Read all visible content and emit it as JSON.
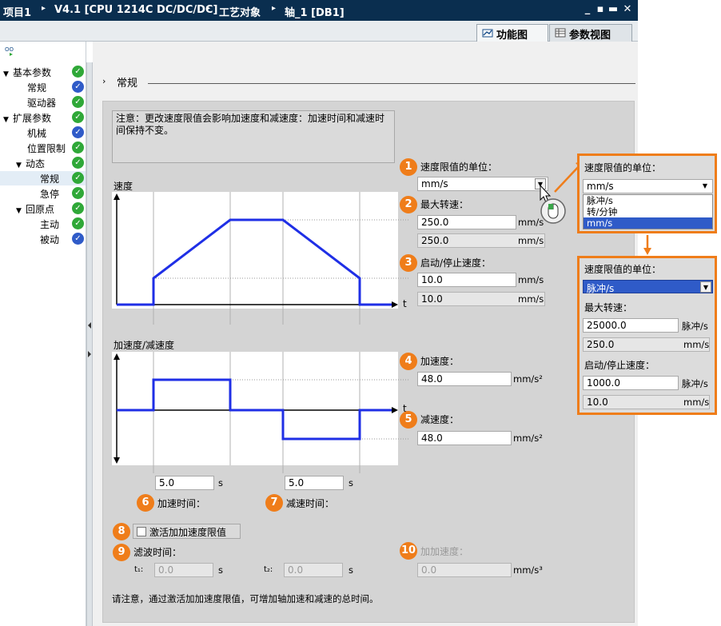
{
  "titlebar": {
    "crumbs": [
      "项目1",
      "V4.1 [CPU 1214C DC/DC/DC]",
      "工艺对象",
      "轴_1 [DB1]"
    ],
    "sep": "▸",
    "win_buttons": [
      "_",
      "▪",
      "▬",
      "✕"
    ]
  },
  "tabs": {
    "function_view": "功能图",
    "param_view": "参数视图"
  },
  "tree": {
    "items": [
      {
        "label": "基本参数",
        "arrow": "▼",
        "status": "green"
      },
      {
        "label": "常规",
        "arrow": "",
        "status": "blue"
      },
      {
        "label": "驱动器",
        "arrow": "",
        "status": "green"
      },
      {
        "label": "扩展参数",
        "arrow": "▼",
        "status": "green"
      },
      {
        "label": "机械",
        "arrow": "",
        "status": "blue"
      },
      {
        "label": "位置限制",
        "arrow": "",
        "status": "green"
      },
      {
        "label": "动态",
        "arrow": "▼",
        "status": "green"
      },
      {
        "label": "常规",
        "arrow": "",
        "status": "green"
      },
      {
        "label": "急停",
        "arrow": "",
        "status": "green"
      },
      {
        "label": "回原点",
        "arrow": "▼",
        "status": "green"
      },
      {
        "label": "主动",
        "arrow": "",
        "status": "green"
      },
      {
        "label": "被动",
        "arrow": "",
        "status": "blue"
      }
    ]
  },
  "section": {
    "arrow": "›",
    "title": "常规"
  },
  "note": "注意：更改速度限值会影响加速度和减速度：加速时间和减速时间保持不变。",
  "chart1": {
    "ylabel": "速度",
    "xlabel": "t"
  },
  "chart2": {
    "ylabel": "加速度/减速度",
    "xlabel": "t"
  },
  "fields": {
    "unit_label": "速度限值的单位：",
    "unit_value": "mm/s",
    "max_speed_label": "最大转速：",
    "max_speed_value": "250.0",
    "max_speed_unit": "mm/s",
    "max_speed_ro": "250.0",
    "max_speed_ro_unit": "mm/s",
    "start_stop_label": "启动/停止速度：",
    "start_stop_value": "10.0",
    "start_stop_unit": "mm/s",
    "start_stop_ro": "10.0",
    "start_stop_ro_unit": "mm/s",
    "accel_label": "加速度：",
    "accel_value": "48.0",
    "accel_unit": "mm/s²",
    "decel_label": "减速度：",
    "decel_value": "48.0",
    "decel_unit": "mm/s²",
    "accel_time_value": "5.0",
    "accel_time_unit": "s",
    "accel_time_label": "加速时间：",
    "decel_time_value": "5.0",
    "decel_time_unit": "s",
    "decel_time_label": "减速时间：",
    "jerk_checkbox_label": "激活加加速度限值",
    "filter_time_label": "滤波时间：",
    "t1_label": "t₁:",
    "t1_value": "0.0",
    "t1_unit": "s",
    "t2_label": "t₂:",
    "t2_value": "0.0",
    "t2_unit": "s",
    "jerk_label": "加加速度：",
    "jerk_value": "0.0",
    "jerk_unit": "mm/s³",
    "footer_note": "请注意，通过激活加加速度限值，可增加轴加速和减速的总时间。"
  },
  "badges": [
    "1",
    "2",
    "3",
    "4",
    "5",
    "6",
    "7",
    "8",
    "9",
    "10"
  ],
  "popup1": {
    "label": "速度限值的单位：",
    "value": "mm/s",
    "options": [
      "脉冲/s",
      "转/分钟",
      "mm/s"
    ],
    "selected_index": 2
  },
  "popup2": {
    "unit_label": "速度限值的单位：",
    "unit_value": "脉冲/s",
    "max_speed_label": "最大转速：",
    "max_speed_value": "25000.0",
    "max_speed_unit": "脉冲/s",
    "max_speed_ro": "250.0",
    "max_speed_ro_unit": "mm/s",
    "start_stop_label": "启动/停止速度：",
    "start_stop_value": "1000.0",
    "start_stop_unit": "脉冲/s",
    "start_stop_ro": "10.0",
    "start_stop_ro_unit": "mm/s"
  },
  "colors": {
    "accent": "#ef7d1a",
    "profile": "#1f2fe6",
    "title_bg": "#0a2e4f",
    "check_green": "#2fa838",
    "check_blue": "#2f5bc8"
  }
}
